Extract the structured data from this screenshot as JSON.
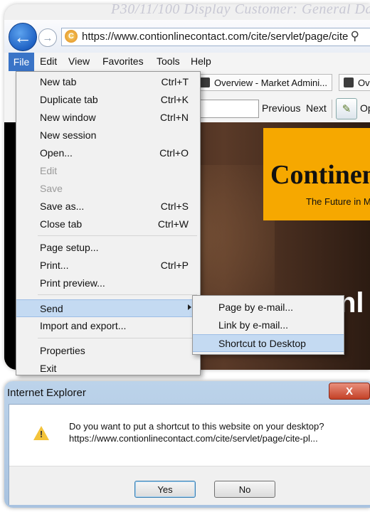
{
  "browser": {
    "faded_title": "P30/11/100 Display Customer: General Data",
    "url": "https://www.contionlinecontact.com/cite/servlet/page/cite",
    "menu": [
      "File",
      "Edit",
      "View",
      "Favorites",
      "Tools",
      "Help"
    ],
    "favorites": [
      "Overview - Market Admini...",
      "Ove"
    ],
    "find": {
      "previous": "Previous",
      "next": "Next",
      "options_partial": "Op"
    },
    "page": {
      "logo_text": "Continen",
      "tagline": "The Future in M",
      "background_text": "nl"
    }
  },
  "file_menu": {
    "items": [
      {
        "label": "New tab",
        "shortcut": "Ctrl+T"
      },
      {
        "label": "Duplicate tab",
        "shortcut": "Ctrl+K"
      },
      {
        "label": "New window",
        "shortcut": "Ctrl+N"
      },
      {
        "label": "New session",
        "shortcut": ""
      },
      {
        "label": "Open...",
        "shortcut": "Ctrl+O"
      },
      {
        "label": "Edit",
        "shortcut": ""
      },
      {
        "label": "Save",
        "shortcut": ""
      },
      {
        "label": "Save as...",
        "shortcut": "Ctrl+S"
      },
      {
        "label": "Close tab",
        "shortcut": "Ctrl+W"
      },
      {
        "label": "Page setup...",
        "shortcut": ""
      },
      {
        "label": "Print...",
        "shortcut": "Ctrl+P"
      },
      {
        "label": "Print preview...",
        "shortcut": ""
      },
      {
        "label": "Send",
        "shortcut": ""
      },
      {
        "label": "Import and export...",
        "shortcut": ""
      },
      {
        "label": "Properties",
        "shortcut": ""
      },
      {
        "label": "Exit",
        "shortcut": ""
      }
    ]
  },
  "send_submenu": {
    "items": [
      "Page by e-mail...",
      "Link by e-mail...",
      "Shortcut to Desktop"
    ]
  },
  "dialog": {
    "title": "Internet Explorer",
    "close_label": "X",
    "message_line1": "Do you want to put a shortcut to this website on your desktop?",
    "message_line2": "https://www.contionlinecontact.com/cite/servlet/page/cite-pl...",
    "yes_label": "Yes",
    "no_label": "No"
  }
}
